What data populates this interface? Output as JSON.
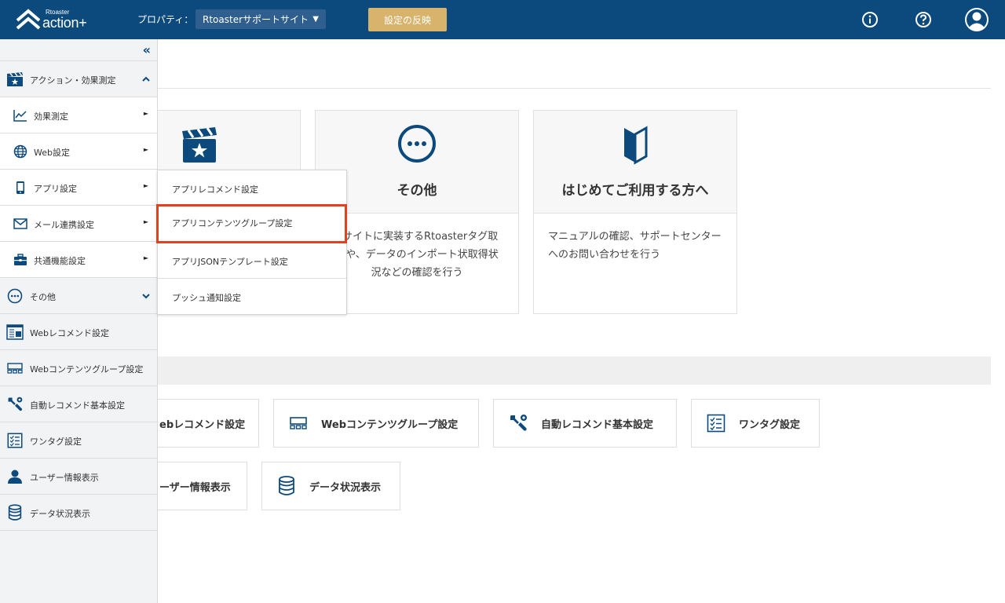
{
  "header": {
    "brand_small": "Rtoaster",
    "brand_big": "action+",
    "property_label": "プロパティ：",
    "property_value": "Rtoasterサポートサイト",
    "property_arrow": "▼",
    "apply_label": "設定の反映",
    "icons": [
      "info-icon",
      "help-icon",
      "user-avatar-icon"
    ]
  },
  "sidebar": {
    "collapse_icon": "«",
    "items": [
      {
        "label": "アクション・効果測定",
        "icon": "clapper-star-icon",
        "right": "⌃"
      },
      {
        "label": "効果測定",
        "icon": "chart-line-icon",
        "right": "►"
      },
      {
        "label": "Web設定",
        "icon": "globe-icon",
        "right": "►"
      },
      {
        "label": "アプリ設定",
        "icon": "smartphone-icon",
        "right": "►"
      },
      {
        "label": "メール連携設定",
        "icon": "mail-icon",
        "right": "►"
      },
      {
        "label": "共通機能設定",
        "icon": "briefcase-icon",
        "right": "►"
      },
      {
        "label": "その他",
        "icon": "more-circle-icon",
        "right": "⌄"
      },
      {
        "label": "Webレコメンド設定",
        "icon": "web-recommend-icon"
      },
      {
        "label": "Webコンテンツグループ設定",
        "icon": "content-group-icon"
      },
      {
        "label": "自動レコメンド基本設定",
        "icon": "wrench-icon"
      },
      {
        "label": "ワンタグ設定",
        "icon": "checklist-icon"
      },
      {
        "label": "ユーザー情報表示",
        "icon": "user-icon"
      },
      {
        "label": "データ状況表示",
        "icon": "database-icon"
      }
    ]
  },
  "flyout": {
    "items": [
      {
        "label": "アプリレコメンド設定"
      },
      {
        "label": "アプリコンテンツグループ設定"
      },
      {
        "label": "アプリJSONテンプレート設定"
      },
      {
        "label": "プッシュ通知設定"
      }
    ]
  },
  "cards": [
    {
      "title": "",
      "icon": "clapper-star-icon",
      "desc": ""
    },
    {
      "title": "その他",
      "icon": "more-circle-icon",
      "desc": "pサイトに実装するRtoasterタグ取得や、データのインポート状取得状況などの確認を行う"
    },
    {
      "title": "はじめてご利用する方へ",
      "icon": "beginner-mark-icon",
      "desc": "マニュアルの確認、サポートセンターへのお問い合わせを行う"
    }
  ],
  "tiles": [
    {
      "label": "ebレコメンド設定",
      "icon": "web-recommend-icon"
    },
    {
      "label": "Webコンテンツグループ設定",
      "icon": "content-group-icon"
    },
    {
      "label": "自動レコメンド基本設定",
      "icon": "wrench-icon"
    },
    {
      "label": "ワンタグ設定",
      "icon": "checklist-icon"
    },
    {
      "label": "ーザー情報表示",
      "icon": "user-icon"
    },
    {
      "label": "データ状況表示",
      "icon": "database-icon"
    }
  ],
  "colors": {
    "header_bg": "#0c4a7d",
    "apply_bg": "#d7b36b",
    "highlight": "#e3401e",
    "icon_blue": "#0c4a7d"
  }
}
